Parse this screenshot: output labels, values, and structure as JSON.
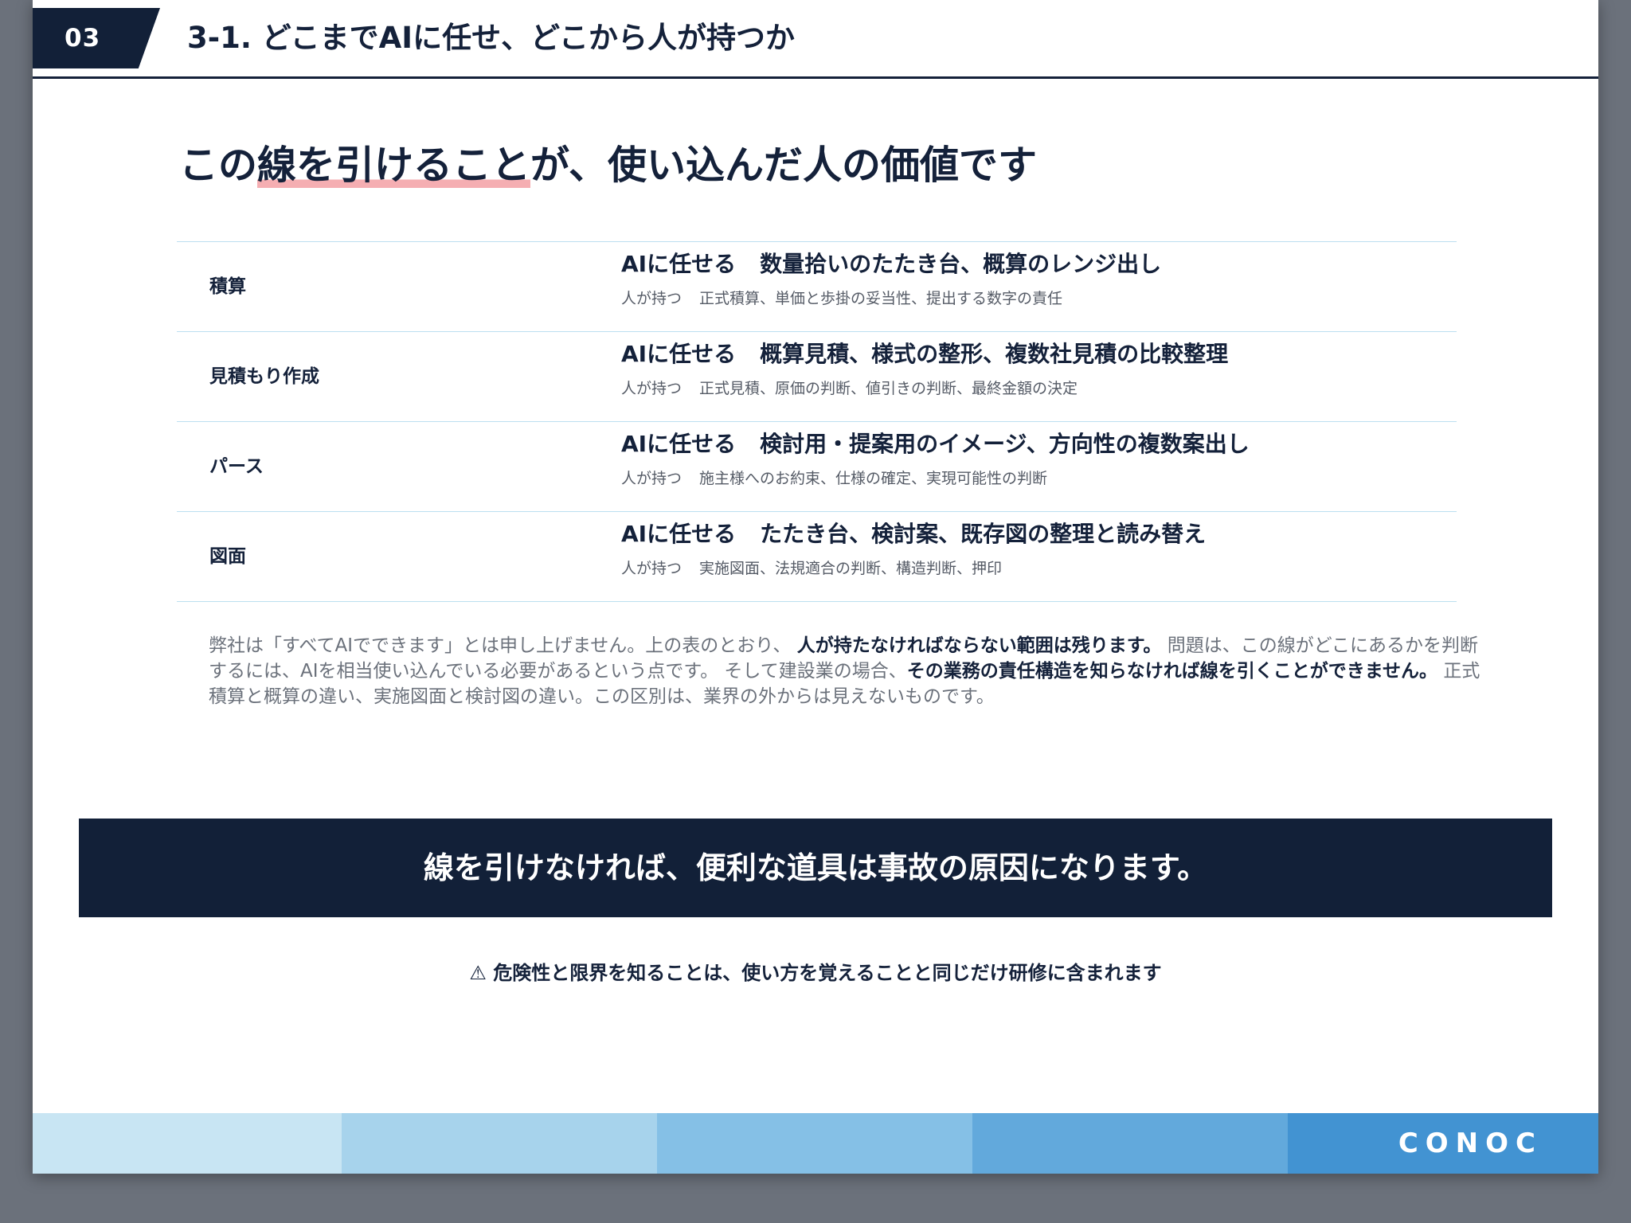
{
  "header": {
    "chapter_number": "03",
    "title": "3-1. どこまでAIに任せ、どこから人が持つか"
  },
  "headline": {
    "before": "この",
    "highlight": "線を引けること",
    "after": "が、使い込んだ人の価値です"
  },
  "table": {
    "ai_tag": "AIに任せる",
    "human_tag": "人が持つ",
    "rows": [
      {
        "label": "積算",
        "ai": "数量拾いのたたき台、概算のレンジ出し",
        "human": "正式積算、単価と歩掛の妥当性、提出する数字の責任"
      },
      {
        "label": "見積もり作成",
        "ai": "概算見積、様式の整形、複数社見積の比較整理",
        "human": "正式見積、原価の判断、値引きの判断、最終金額の決定"
      },
      {
        "label": "パース",
        "ai": "検討用・提案用のイメージ、方向性の複数案出し",
        "human": "施主様へのお約束、仕様の確定、実現可能性の判断"
      },
      {
        "label": "図面",
        "ai": "たたき台、検討案、既存図の整理と読み替え",
        "human": "実施図面、法規適合の判断、構造判断、押印"
      }
    ]
  },
  "paragraph": {
    "p1": "弊社は「すべてAIでできます」とは申し上げません。上の表のとおり、",
    "b1": "人が持たなければならない範囲は残ります。",
    "p2": "問題は、この線がどこにあるかを判断するには、AIを相当使い込んでいる必要があるという点です。 そして建設業の場合、",
    "b2": "その業務の責任構造を知らなければ線を引くことができません。",
    "p3": "正式積算と概算の違い、実施図面と検討図の違い。この区別は、業界の外からは見えないものです。"
  },
  "banner": {
    "text": "線を引けなければ、便利な道具は事故の原因になります。"
  },
  "note": {
    "icon": "warning-icon",
    "text": "⚠ 危険性と限界を知ることは、使い方を覚えることと同じだけ研修に含まれます"
  },
  "footer": {
    "logo_text": "CONOC",
    "band_colors": [
      "#c8e5f3",
      "#a7d3ec",
      "#85c0e6",
      "#62a9dc",
      "#4293d2"
    ]
  },
  "colors": {
    "navy": "#122038",
    "highlight": "#f5aeb2",
    "rule": "#bcdff0",
    "backdrop": "#6b717b"
  }
}
